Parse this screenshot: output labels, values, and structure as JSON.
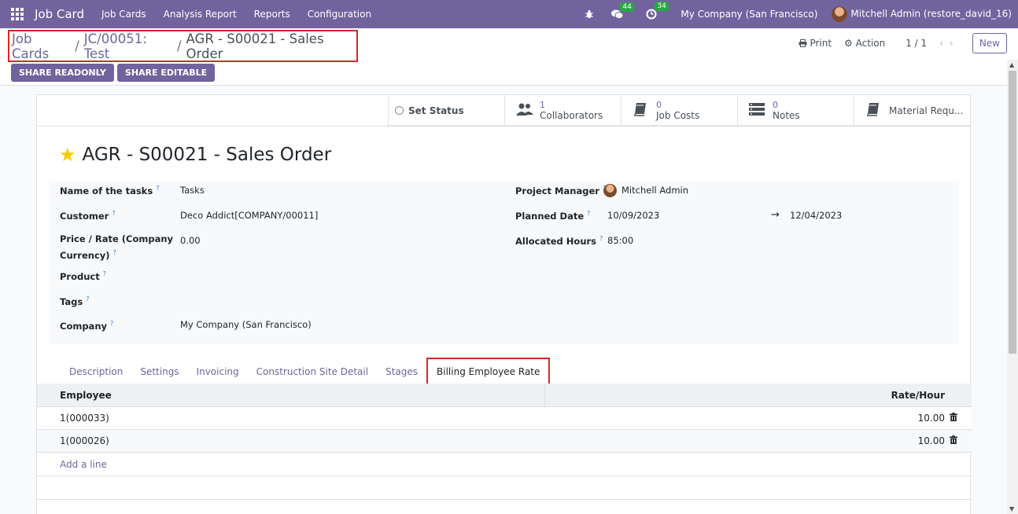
{
  "navbar": {
    "app_title": "Job Card",
    "menu": [
      "Job Cards",
      "Analysis Report",
      "Reports",
      "Configuration"
    ],
    "messages_count": "44",
    "activities_count": "34",
    "company": "My Company (San Francisco)",
    "user": "Mitchell Admin (restore_david_16)"
  },
  "breadcrumb": {
    "items": [
      "Job Cards",
      "JC/00051: Test"
    ],
    "current": "AGR - S00021 - Sales Order",
    "separator": "/"
  },
  "actions": {
    "print": "Print",
    "action": "Action",
    "pager": "1 / 1",
    "new": "New"
  },
  "share": {
    "readonly": "SHARE READONLY",
    "editable": "SHARE EDITABLE"
  },
  "button_box": {
    "set_status": "Set Status",
    "collaborators": {
      "value": "1",
      "label": "Collaborators"
    },
    "job_costs": {
      "value": "0",
      "label": "Job Costs"
    },
    "notes": {
      "value": "0",
      "label": "Notes"
    },
    "material": {
      "label": "Material Requ..."
    }
  },
  "record": {
    "title": "AGR - S00021 - Sales Order"
  },
  "fields": {
    "name_of_tasks": {
      "label": "Name of the tasks",
      "value": "Tasks"
    },
    "customer": {
      "label": "Customer",
      "value": "Deco Addict[COMPANY/00011]"
    },
    "price_rate_1": "Price / Rate (Company",
    "price_rate_2": "Currency)",
    "price_rate_value": "0.00",
    "product": {
      "label": "Product"
    },
    "tags": {
      "label": "Tags"
    },
    "company": {
      "label": "Company",
      "value": "My Company (San Francisco)"
    },
    "project_manager": {
      "label": "Project Manager",
      "value": "Mitchell Admin"
    },
    "planned_date": {
      "label": "Planned Date",
      "start": "10/09/2023",
      "end": "12/04/2023"
    },
    "allocated_hours": {
      "label": "Allocated Hours",
      "value": "85:00"
    }
  },
  "help_mark": "?",
  "tabs": [
    "Description",
    "Settings",
    "Invoicing",
    "Construction Site Detail",
    "Stages",
    "Billing Employee Rate"
  ],
  "active_tab": "Billing Employee Rate",
  "table": {
    "columns": [
      "Employee",
      "Rate/Hour"
    ],
    "rows": [
      {
        "employee": "1(000033)",
        "rate": "10.00"
      },
      {
        "employee": "1(000026)",
        "rate": "10.00"
      }
    ],
    "add_line": "Add a line"
  },
  "colors": {
    "brand": "#71639e",
    "highlight": "#d92626",
    "star": "#f3cc00"
  }
}
